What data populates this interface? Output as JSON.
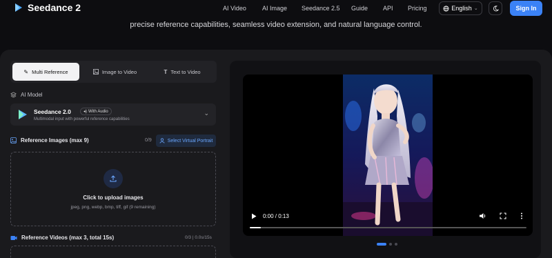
{
  "nav": {
    "brand": "Seedance 2",
    "links": [
      "AI Video",
      "AI Image",
      "Seedance 2.5",
      "Guide",
      "API",
      "Pricing"
    ],
    "language": "English",
    "signin": "Sign In"
  },
  "tagline": "precise reference capabilities, seamless video extension, and natural language control.",
  "tabs": [
    {
      "label": "Multi Reference",
      "icon": "wand-icon",
      "active": true
    },
    {
      "label": "Image to Video",
      "icon": "image-icon",
      "active": false
    },
    {
      "label": "Text to Video",
      "icon": "text-icon",
      "active": false
    }
  ],
  "model": {
    "section_label": "AI Model",
    "name": "Seedance 2.0",
    "badge": "With Audio",
    "description": "Multimodal input with powerful reference capabilities"
  },
  "reference_images": {
    "title": "Reference Images (max 9)",
    "count": "0/9",
    "virtual_button": "Select Virtual Portrait",
    "upload_title": "Click to upload images",
    "upload_sub": "jpeg, png, webp, bmp, tiff, gif (9 remaining)"
  },
  "reference_videos": {
    "title": "Reference Videos (max 3, total 15s)",
    "count": "0/3 | 0.0s/15s"
  },
  "video": {
    "time": "0:00 / 0:13",
    "progress": 0.04
  },
  "carousel": {
    "total": 3,
    "active_index": 0
  },
  "colors": {
    "accent": "#3b82f6",
    "background": "#0d0d10",
    "panel": "#1a1a1d"
  }
}
